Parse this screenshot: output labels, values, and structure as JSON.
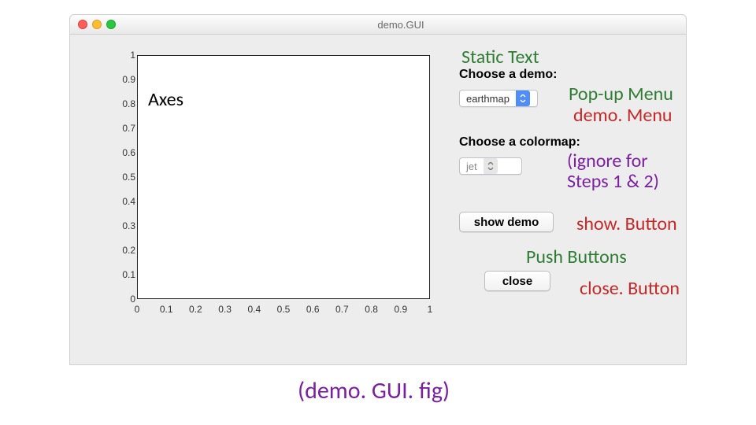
{
  "window": {
    "title": "demo.GUI"
  },
  "labels": {
    "choose_demo": "Choose a demo:",
    "choose_colormap": "Choose a colormap:"
  },
  "popups": {
    "demo_value": "earthmap",
    "colormap_value": "jet"
  },
  "buttons": {
    "show_demo": "show demo",
    "close": "close"
  },
  "annotations": {
    "static_text": "Static Text",
    "axes": "Axes",
    "popup_menu": "Pop-up Menu",
    "demo_menu": "demo. Menu",
    "ignore_l1": "(ignore for",
    "ignore_l2": "   Steps 1 & 2)",
    "show_button": "show. Button",
    "push_buttons": "Push Buttons",
    "close_button": "close. Button",
    "figfile": "(demo. GUI. fig)"
  },
  "chart_data": {
    "type": "line",
    "title": "",
    "xlabel": "",
    "ylabel": "",
    "xlim": [
      0,
      1
    ],
    "ylim": [
      0,
      1
    ],
    "x_ticks": [
      0,
      0.1,
      0.2,
      0.3,
      0.4,
      0.5,
      0.6,
      0.7,
      0.8,
      0.9,
      1
    ],
    "y_ticks": [
      0,
      0.1,
      0.2,
      0.3,
      0.4,
      0.5,
      0.6,
      0.7,
      0.8,
      0.9,
      1
    ],
    "x_tick_labels": [
      "0",
      "0.1",
      "0.2",
      "0.3",
      "0.4",
      "0.5",
      "0.6",
      "0.7",
      "0.8",
      "0.9",
      "1"
    ],
    "y_tick_labels": [
      "0",
      "0.1",
      "0.2",
      "0.3",
      "0.4",
      "0.5",
      "0.6",
      "0.7",
      "0.8",
      "0.9",
      "1"
    ],
    "series": []
  }
}
